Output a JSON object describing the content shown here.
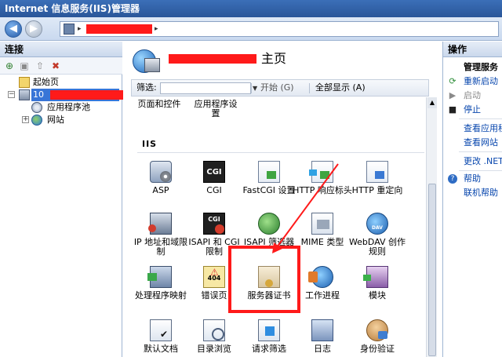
{
  "window": {
    "title": "Internet 信息服务(IIS)管理器"
  },
  "address": {
    "separator": "▸",
    "trail_arrow": "▸"
  },
  "left_panel": {
    "title": "连接",
    "tree": [
      {
        "label": "起始页"
      },
      {
        "label": "10"
      },
      {
        "label": "应用程序池"
      },
      {
        "label": "网站"
      }
    ]
  },
  "center": {
    "header_title": "主页",
    "filter": {
      "label": "筛选:",
      "start": "开始 (G)",
      "show_all": "全部显示 (A)"
    },
    "prev_items": [
      {
        "label": "页面和控件"
      },
      {
        "label": "应用程序设置"
      }
    ],
    "section": "IIS",
    "features": [
      {
        "label": "ASP"
      },
      {
        "label": "CGI"
      },
      {
        "label": "FastCGI 设置"
      },
      {
        "label": "HTTP 响应标头"
      },
      {
        "label": "HTTP 重定向"
      },
      {
        "label": "IP 地址和域限制"
      },
      {
        "label": "ISAPI 和 CGI 限制"
      },
      {
        "label": "ISAPI 筛选器"
      },
      {
        "label": "MIME 类型"
      },
      {
        "label": "WebDAV 创作规则"
      },
      {
        "label": "处理程序映射"
      },
      {
        "label": "错误页"
      },
      {
        "label": "服务器证书"
      },
      {
        "label": "工作进程"
      },
      {
        "label": "模块"
      },
      {
        "label": "默认文档"
      },
      {
        "label": "目录浏览"
      },
      {
        "label": "请求筛选"
      },
      {
        "label": "日志"
      },
      {
        "label": "身份验证"
      }
    ],
    "highlight_color": "#ff1a1a"
  },
  "right_panel": {
    "title": "操作",
    "actions": [
      {
        "label": "管理服务"
      },
      {
        "label": "重新启动"
      },
      {
        "label": "启动"
      },
      {
        "label": "停止"
      },
      {
        "label": "查看应用程"
      },
      {
        "label": "查看网站"
      },
      {
        "label": "更改 .NET"
      },
      {
        "label": "帮助"
      },
      {
        "label": "联机帮助"
      }
    ]
  }
}
